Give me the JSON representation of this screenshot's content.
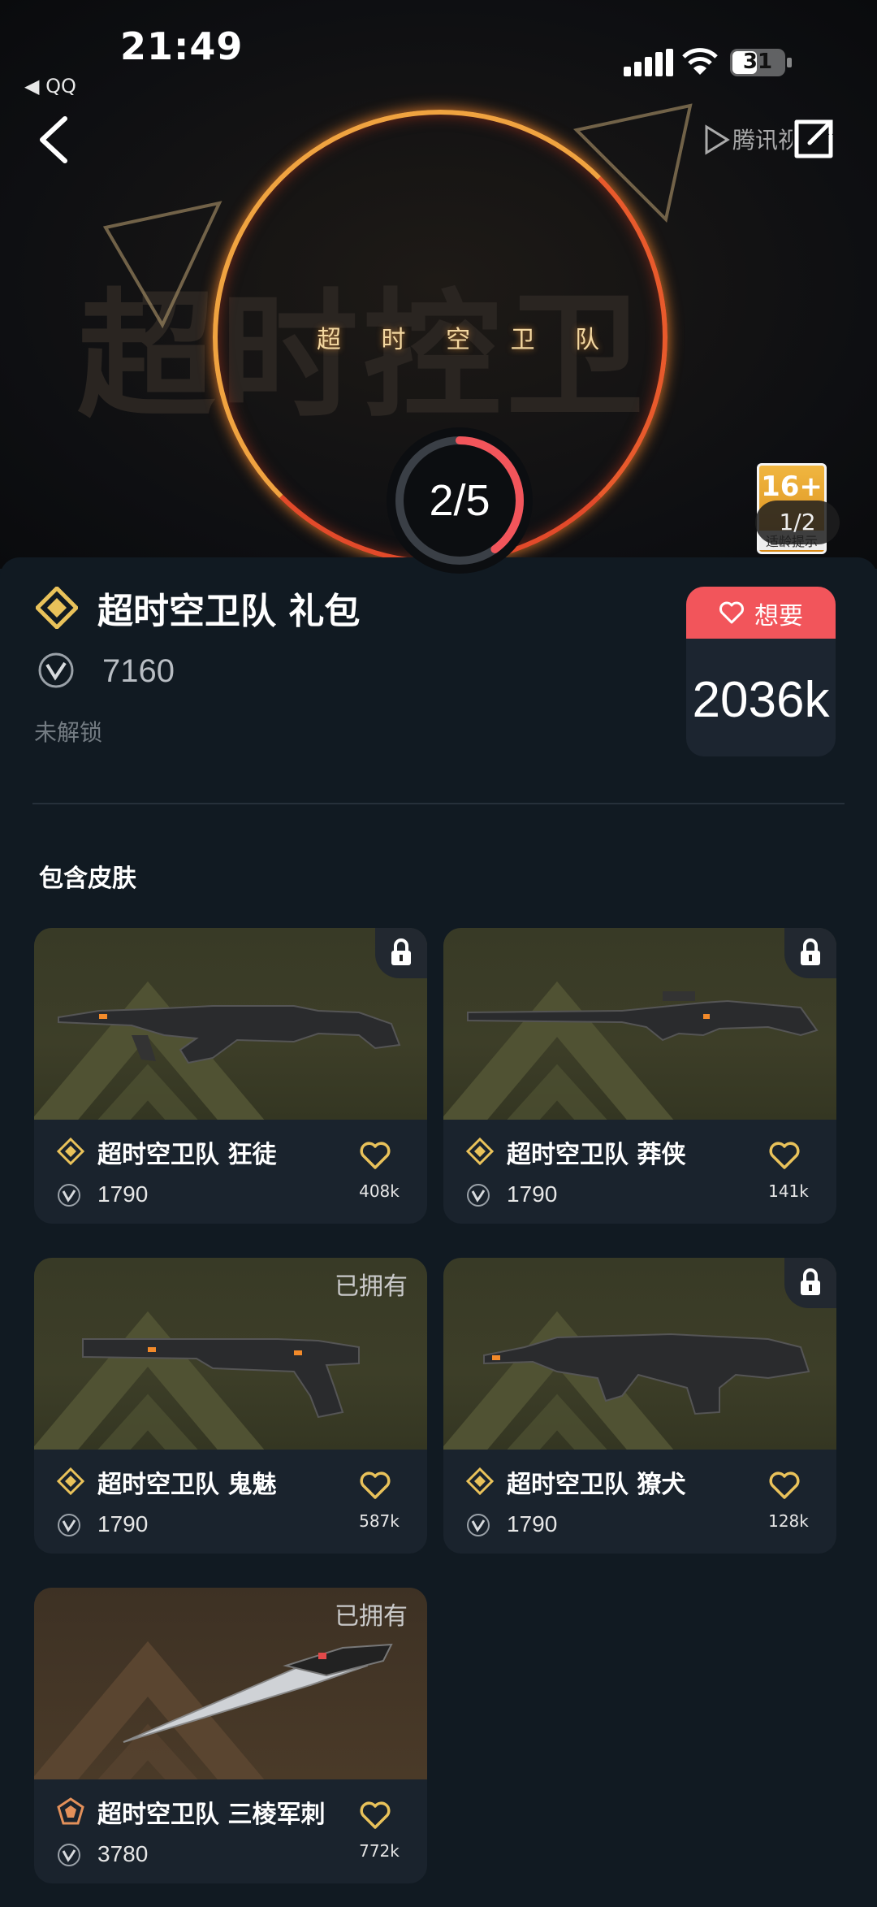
{
  "status_bar": {
    "time": "21:49",
    "back_app": "◀ QQ",
    "battery": "31"
  },
  "hero": {
    "bg_text": "超时控卫",
    "title": "超 时 空 卫 队",
    "watermark": "腾讯视频",
    "age_badge": "16+",
    "age_note": "适龄提示",
    "page_indicator": "1/2",
    "progress": {
      "label": "2/5",
      "current": 2,
      "total": 5
    }
  },
  "bundle": {
    "title": "超时空卫队 礼包",
    "price": "7160",
    "status": "未解锁",
    "want_label": "想要",
    "want_count": "2036k"
  },
  "section_title": "包含皮肤",
  "skins": [
    {
      "name": "超时空卫队 狂徒",
      "price": "1790",
      "likes": "408k",
      "locked": true,
      "owned_label": "",
      "weapon": "vandal"
    },
    {
      "name": "超时空卫队 莽侠",
      "price": "1790",
      "likes": "141k",
      "locked": true,
      "owned_label": "",
      "weapon": "marshal"
    },
    {
      "name": "超时空卫队 鬼魅",
      "price": "1790",
      "likes": "587k",
      "locked": false,
      "owned_label": "已拥有",
      "weapon": "ghost"
    },
    {
      "name": "超时空卫队 獠犬",
      "price": "1790",
      "likes": "128k",
      "locked": true,
      "owned_label": "",
      "weapon": "spectre"
    },
    {
      "name": "超时空卫队 三棱军刺",
      "price": "3780",
      "likes": "772k",
      "locked": false,
      "owned_label": "已拥有",
      "weapon": "knife"
    }
  ],
  "colors": {
    "accent": "#f2555b",
    "gold": "#e9c25a",
    "bg": "#111a22",
    "card": "#1a232d"
  }
}
